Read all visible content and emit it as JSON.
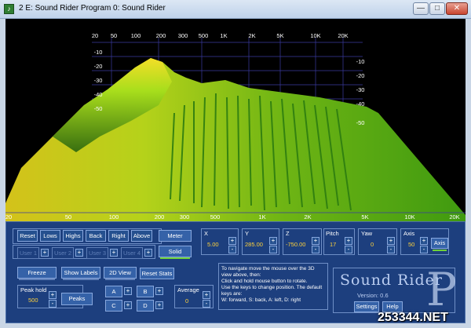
{
  "window": {
    "title": "2 E: Sound Rider Program 0: Sound Rider",
    "minimize_glyph": "—",
    "maximize_glyph": "□",
    "close_glyph": "✕",
    "app_icon_glyph": "♪"
  },
  "view3d": {
    "top_freq_labels": [
      "20",
      "50",
      "100",
      "200",
      "300",
      "500",
      "1K",
      "2K",
      "5K",
      "10K",
      "20K"
    ],
    "bottom_freq_labels": [
      "20",
      "50",
      "100",
      "200",
      "300",
      "500",
      "1K",
      "2K",
      "5K",
      "10K",
      "20K"
    ],
    "left_db_labels": [
      "-10",
      "-20",
      "-30",
      "-40",
      "-50"
    ],
    "right_db_labels": [
      "-10",
      "-20",
      "-30",
      "-40",
      "-50"
    ],
    "colors": {
      "peak": "#ffd21f",
      "mid": "#9ee01a",
      "low": "#1f6b10",
      "grid": "#3a3aa0"
    }
  },
  "controls": {
    "row1": [
      "Reset",
      "Lows",
      "Highs",
      "Back",
      "Right",
      "Above"
    ],
    "meter": "Meter",
    "solid": "Solid",
    "users": [
      "User 1",
      "User 2",
      "User 3",
      "User 4"
    ],
    "row3": [
      "Freeze",
      "Show Labels",
      "2D View",
      "Reset Stats"
    ],
    "peak_hold": {
      "label": "Peak hold",
      "value": "500",
      "peaks": "Peaks"
    },
    "abcd": [
      "A",
      "B",
      "C",
      "D"
    ],
    "average": {
      "label": "Average",
      "value": "0"
    },
    "x": {
      "label": "X",
      "value": "5.00"
    },
    "y": {
      "label": "Y",
      "value": "285.00"
    },
    "z": {
      "label": "Z",
      "value": "-750.00"
    },
    "pitch": {
      "label": "Pitch",
      "value": "17"
    },
    "yaw": {
      "label": "Yaw",
      "value": "0"
    },
    "axis": {
      "label": "Axis",
      "value": "50",
      "button": "Axis"
    },
    "plus": "+",
    "minus": "-",
    "help_text": "To navigate move the mouse over the 3D view above, then:\nClick and hold mouse button to rotate.\nUse the keys to change position. The default keys are:\nW: forward, S: back, A: left, D: right",
    "logo": "Sound Rider",
    "version": "Version: 0.6",
    "settings": "Settings",
    "help": "Help"
  },
  "watermark": "253344.NET"
}
